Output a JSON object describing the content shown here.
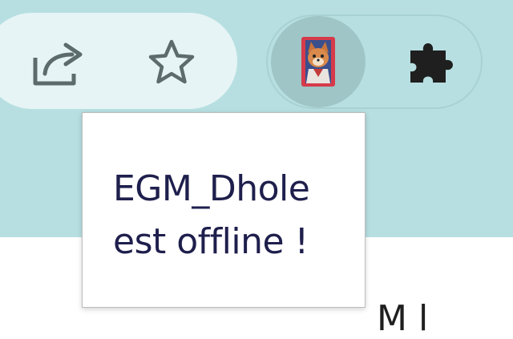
{
  "toolbar": {
    "share_icon": "share-icon",
    "bookmark_icon": "star-icon",
    "extension_icon": "dhole-avatar-icon",
    "extensions_menu_icon": "puzzle-icon",
    "background_color": "#b7dfe1"
  },
  "tooltip": {
    "line1": "EGM_Dhole",
    "line2": "est offline !"
  },
  "page": {
    "peek_text": "M  l"
  }
}
